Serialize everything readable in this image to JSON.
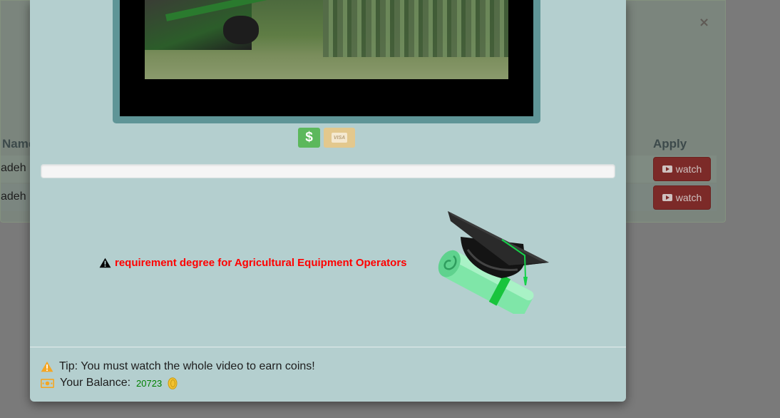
{
  "background": {
    "columns": {
      "name": "Name",
      "apply": "Apply"
    },
    "rows": [
      {
        "name": "adeh",
        "action": "watch"
      },
      {
        "name": "adeh",
        "action": "watch"
      }
    ],
    "close_glyph": "×"
  },
  "modal": {
    "payment_buttons": [
      {
        "icon": "dollar-icon",
        "label": "$"
      },
      {
        "icon": "visa-card-icon",
        "label": "VISA"
      }
    ],
    "progress_percent": 0,
    "requirement_text": "requirement degree for Agricultural Equipment Operators",
    "footer": {
      "tip": "Tip: You must watch the whole video to earn coins!",
      "balance_label": "Your Balance:",
      "balance_value": "20723"
    }
  },
  "colors": {
    "modal_bg": "#b4cfcf",
    "requirement_red": "#ff0000",
    "balance_green": "#008000",
    "dollar_green": "#5cb85c",
    "watch_red": "#7c2a28"
  }
}
